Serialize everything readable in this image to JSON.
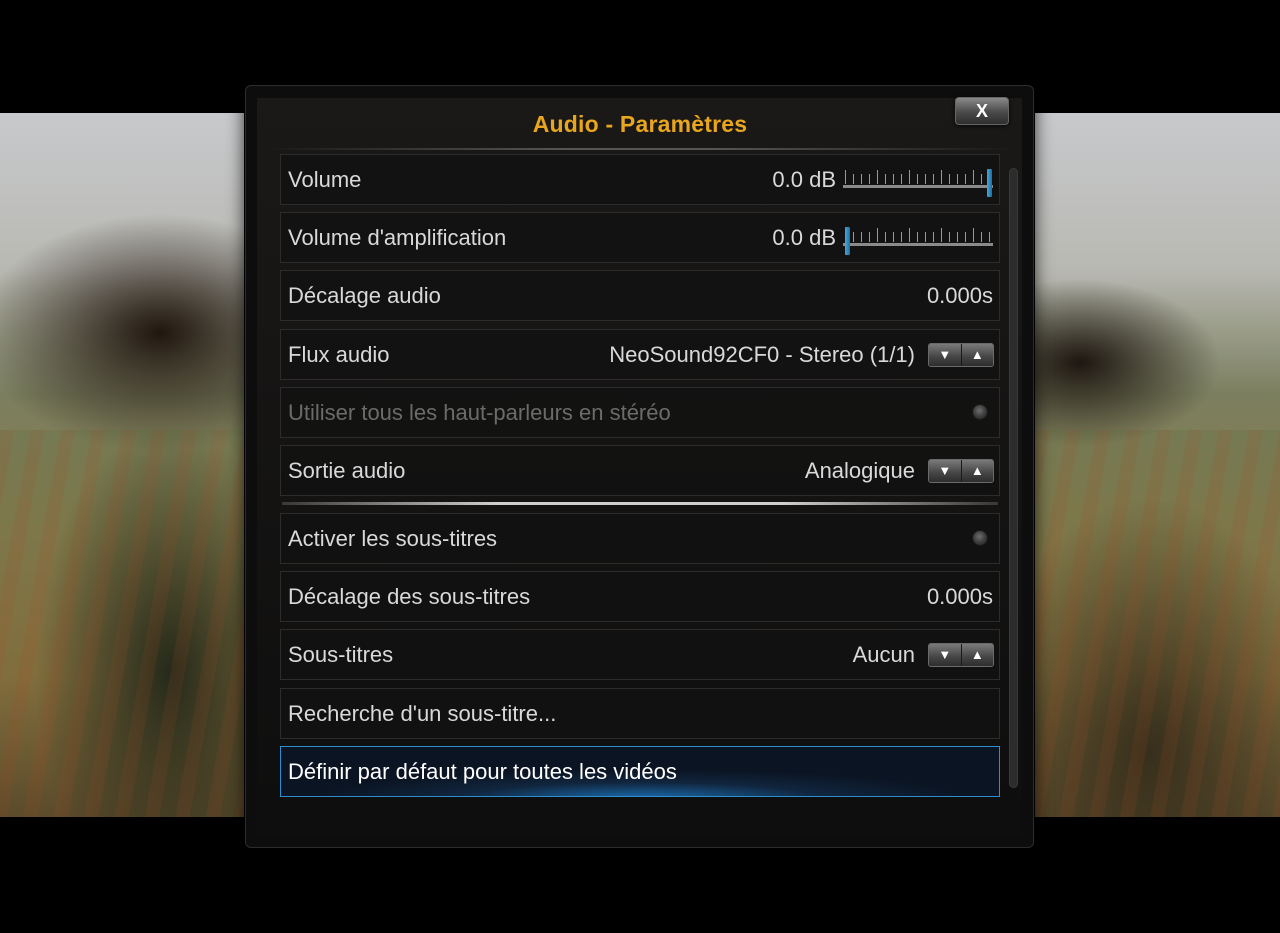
{
  "dialog": {
    "title": "Audio - Paramètres",
    "close_label": "X"
  },
  "rows": [
    {
      "label": "Volume",
      "value": "0.0 dB",
      "control": "slider",
      "level": 1.0
    },
    {
      "label": "Volume d'amplification",
      "value": "0.0 dB",
      "control": "slider",
      "level": 0.0
    },
    {
      "label": "Décalage audio",
      "value": "0.000s",
      "control": "value"
    },
    {
      "label": "Flux audio",
      "value": "NeoSound92CF0 - Stereo (1/1)",
      "control": "spinner"
    },
    {
      "label": "Utiliser tous les haut-parleurs en stéréo",
      "control": "radio",
      "disabled": true
    },
    {
      "label": "Sortie audio",
      "value": "Analogique",
      "control": "spinner"
    },
    {
      "label": "Activer les sous-titres",
      "control": "radio"
    },
    {
      "label": "Décalage des sous-titres",
      "value": "0.000s",
      "control": "value"
    },
    {
      "label": "Sous-titres",
      "value": "Aucun",
      "control": "spinner"
    },
    {
      "label": "Recherche d'un sous-titre...",
      "control": "button"
    },
    {
      "label": "Définir par défaut pour toutes les vidéos",
      "control": "button",
      "focused": true
    }
  ],
  "spinner_icons": {
    "down": "▼",
    "up": "▲"
  },
  "colors": {
    "title": "#e8a51e",
    "focus": "#2d8fd0",
    "slider_knob": "#2f8cc4"
  }
}
